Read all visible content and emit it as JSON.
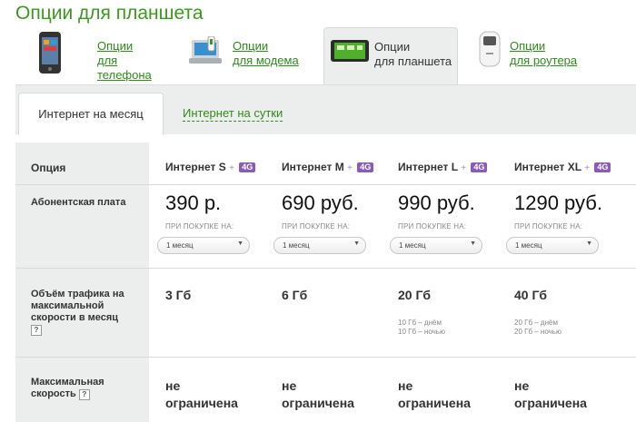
{
  "page_title": "Опции для планшета",
  "device_tabs": [
    {
      "line1": "Опции",
      "line2": "для телефона",
      "icon": "phone-icon",
      "active": false
    },
    {
      "line1": "Опции",
      "line2": "для модема",
      "icon": "modem-icon",
      "active": false
    },
    {
      "line1": "Опции",
      "line2": "для планшета",
      "icon": "tablet-icon",
      "active": true
    },
    {
      "line1": "Опции",
      "line2": "для роутера",
      "icon": "router-icon",
      "active": false
    }
  ],
  "period_tabs": {
    "active": "Интернет на месяц",
    "other": "Интернет на сутки"
  },
  "table": {
    "header_label": "Опция",
    "plans": [
      {
        "name": "Интернет S",
        "price": "390 р.",
        "traffic": "3 Гб",
        "traffic_note1": "",
        "traffic_note2": "",
        "speed1": "не",
        "speed2": "ограничена"
      },
      {
        "name": "Интернет M",
        "price": "690 руб.",
        "traffic": "6 Гб",
        "traffic_note1": "",
        "traffic_note2": "",
        "speed1": "не",
        "speed2": "ограничена"
      },
      {
        "name": "Интернет L",
        "price": "990 руб.",
        "traffic": "20 Гб",
        "traffic_note1": "10 Гб – днём",
        "traffic_note2": "10 Гб – ночью",
        "speed1": "не",
        "speed2": "ограничена"
      },
      {
        "name": "Интернет XL",
        "price": "1290 руб.",
        "traffic": "40 Гб",
        "traffic_note1": "20 Гб – днём",
        "traffic_note2": "20 Гб – ночью",
        "speed1": "не",
        "speed2": "ограничена"
      }
    ],
    "badge": "4G",
    "plus": "+",
    "purchase_note": "ПРИ ПОКУПКЕ НА:",
    "period_select": "1 месяц",
    "row_fee": "Абонентская плата",
    "row_traffic_l1": "Объём трафика на",
    "row_traffic_l2": "максимальной",
    "row_traffic_l3": "скорости в месяц",
    "row_speed_l1": "Максимальная",
    "row_speed_l2": "скорость",
    "help": "?"
  },
  "colors": {
    "accent_green": "#3a9a1e",
    "badge_purple": "#8a5cb8"
  }
}
